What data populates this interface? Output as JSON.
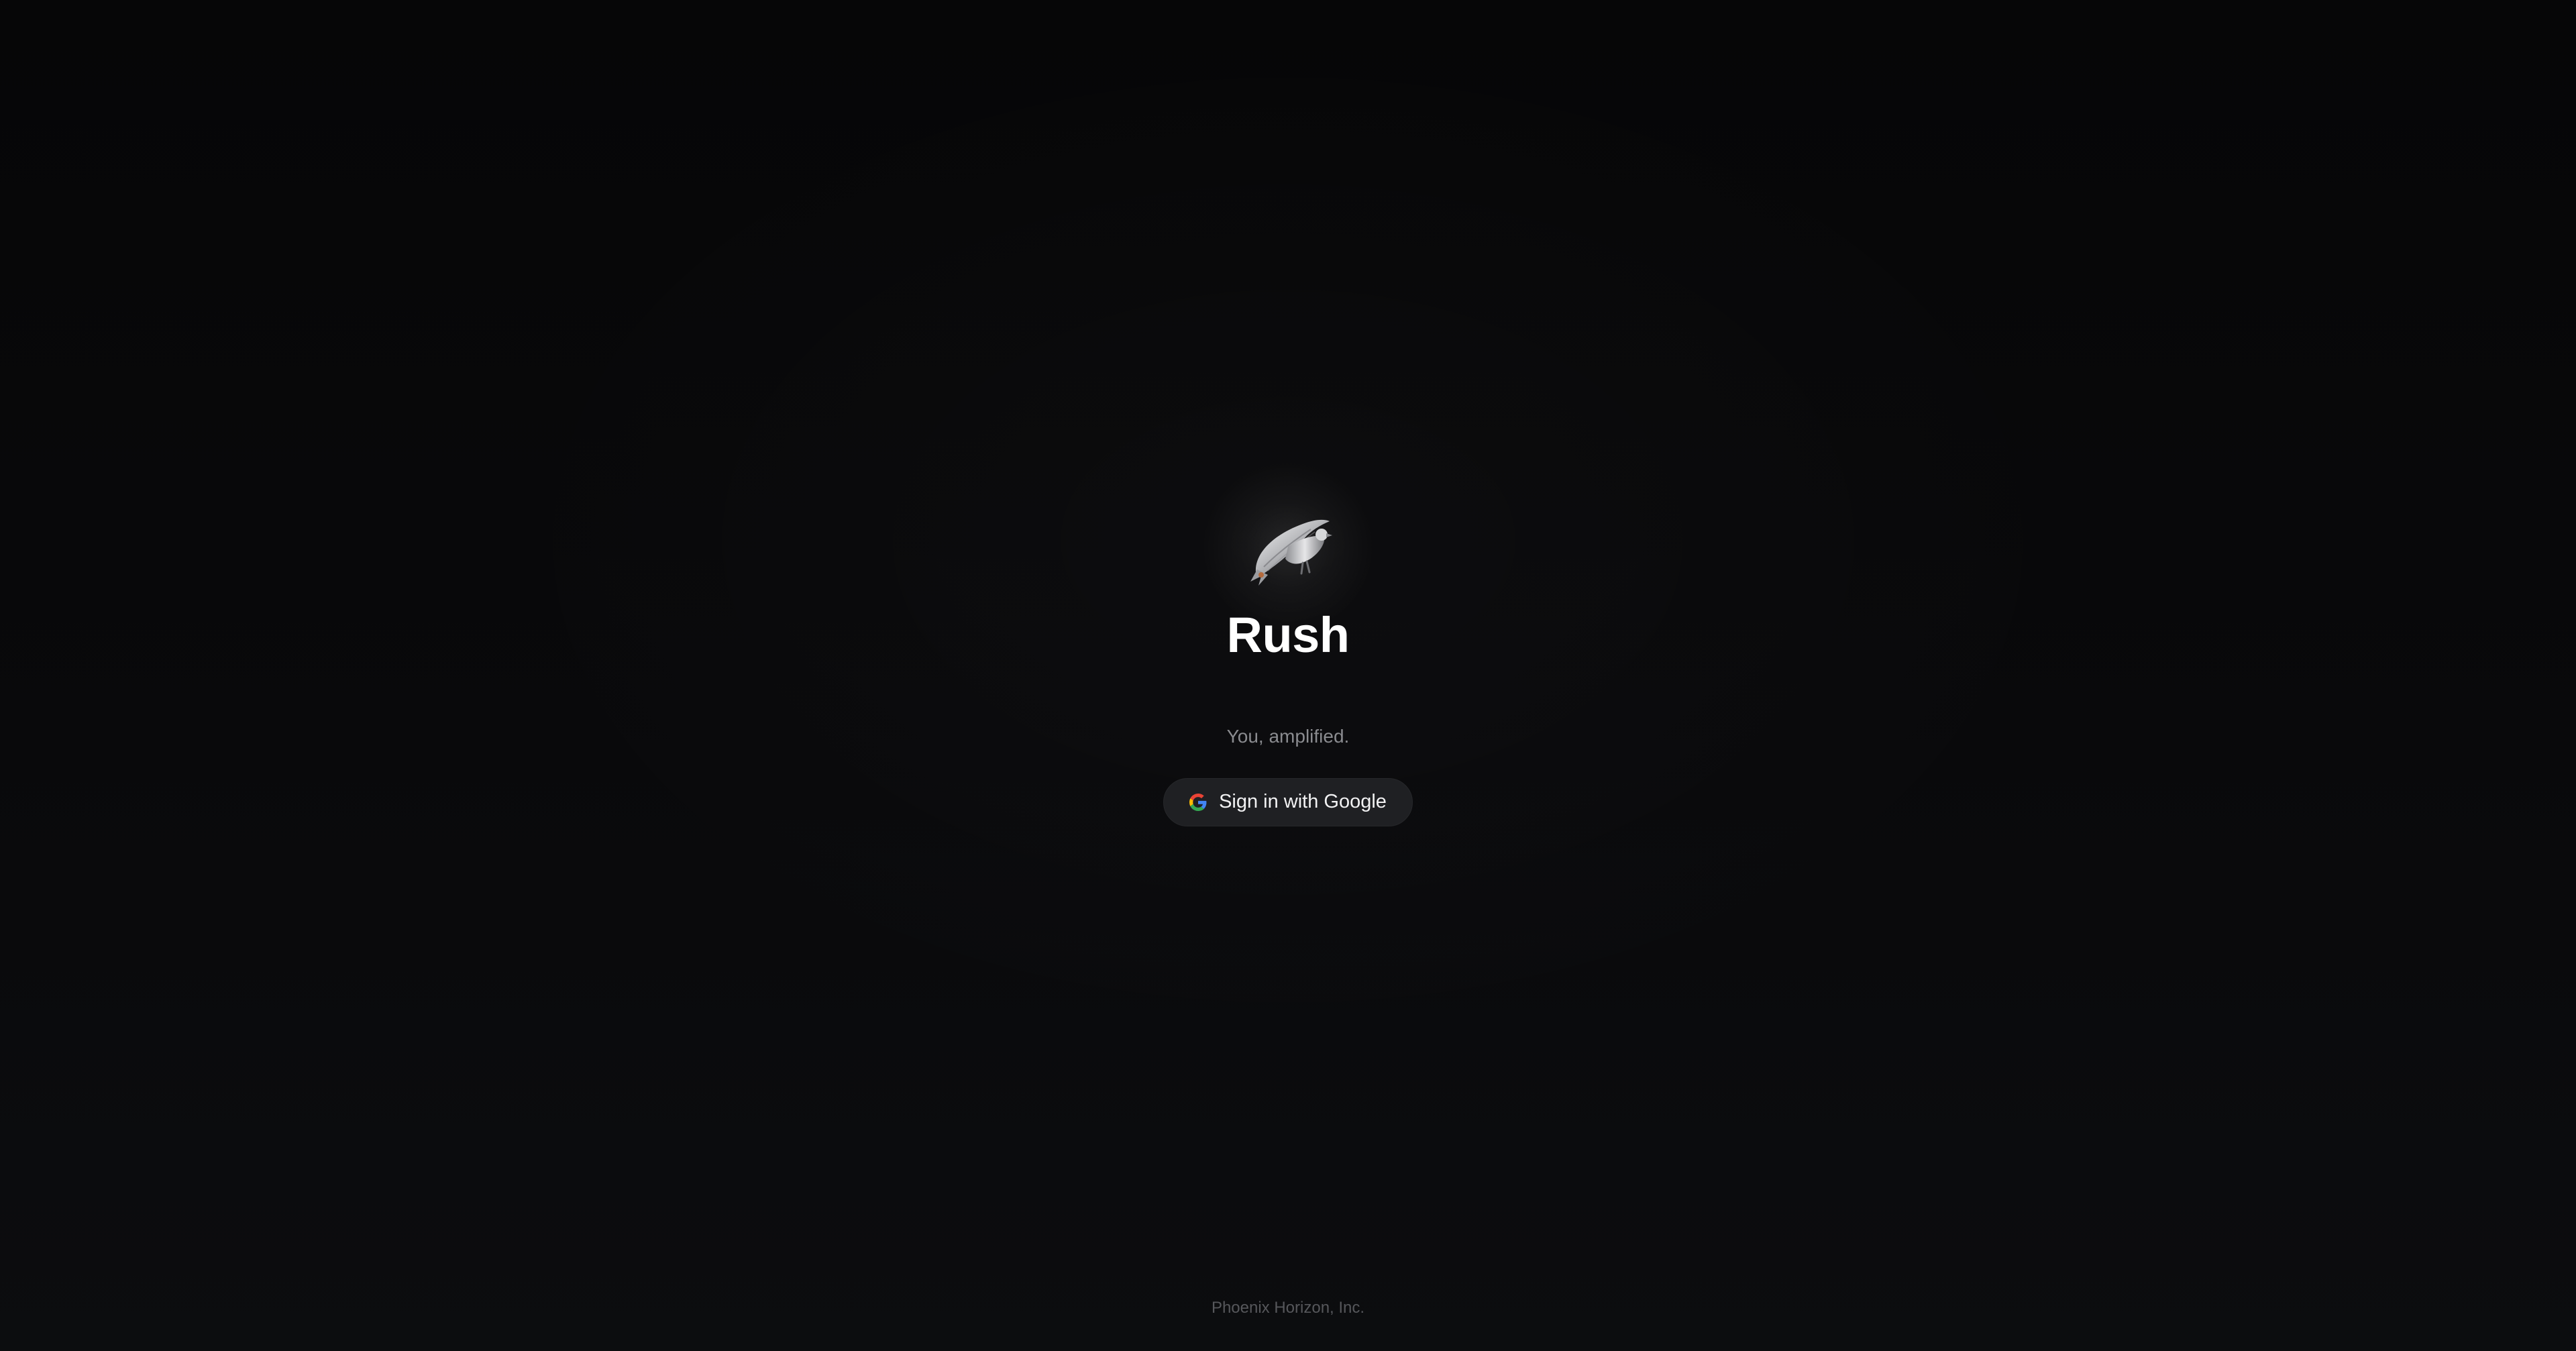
{
  "app": {
    "title": "Rush",
    "tagline": "You, amplified.",
    "logo_icon": "metallic-bird-icon"
  },
  "auth": {
    "google_button_label": "Sign in with Google",
    "google_icon": "google-g-icon"
  },
  "footer": {
    "company": "Phoenix Horizon, Inc."
  },
  "colors": {
    "background": "#09090b",
    "button_bg": "#1f2023",
    "title": "#ffffff",
    "subtitle": "#8a8b8f",
    "footer": "#56575b"
  }
}
